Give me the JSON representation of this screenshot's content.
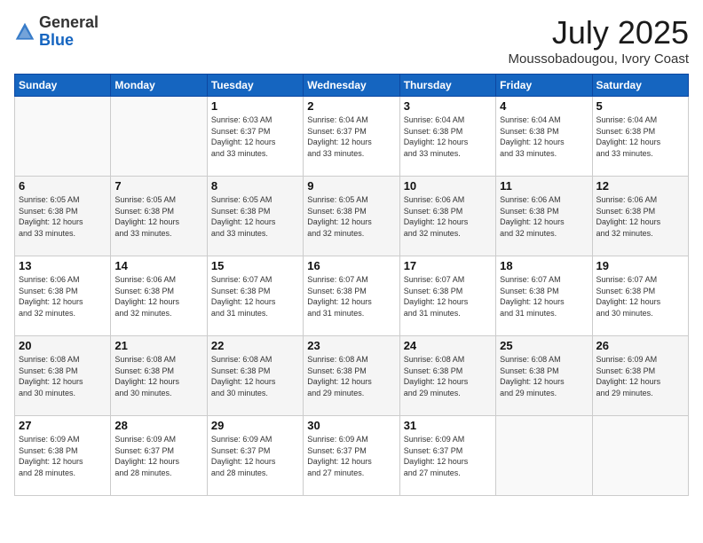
{
  "header": {
    "logo": {
      "general": "General",
      "blue": "Blue"
    },
    "title": "July 2025",
    "location": "Moussobadougou, Ivory Coast"
  },
  "weekdays": [
    "Sunday",
    "Monday",
    "Tuesday",
    "Wednesday",
    "Thursday",
    "Friday",
    "Saturday"
  ],
  "weeks": [
    [
      {
        "day": "",
        "info": ""
      },
      {
        "day": "",
        "info": ""
      },
      {
        "day": "1",
        "info": "Sunrise: 6:03 AM\nSunset: 6:37 PM\nDaylight: 12 hours\nand 33 minutes."
      },
      {
        "day": "2",
        "info": "Sunrise: 6:04 AM\nSunset: 6:37 PM\nDaylight: 12 hours\nand 33 minutes."
      },
      {
        "day": "3",
        "info": "Sunrise: 6:04 AM\nSunset: 6:38 PM\nDaylight: 12 hours\nand 33 minutes."
      },
      {
        "day": "4",
        "info": "Sunrise: 6:04 AM\nSunset: 6:38 PM\nDaylight: 12 hours\nand 33 minutes."
      },
      {
        "day": "5",
        "info": "Sunrise: 6:04 AM\nSunset: 6:38 PM\nDaylight: 12 hours\nand 33 minutes."
      }
    ],
    [
      {
        "day": "6",
        "info": "Sunrise: 6:05 AM\nSunset: 6:38 PM\nDaylight: 12 hours\nand 33 minutes."
      },
      {
        "day": "7",
        "info": "Sunrise: 6:05 AM\nSunset: 6:38 PM\nDaylight: 12 hours\nand 33 minutes."
      },
      {
        "day": "8",
        "info": "Sunrise: 6:05 AM\nSunset: 6:38 PM\nDaylight: 12 hours\nand 33 minutes."
      },
      {
        "day": "9",
        "info": "Sunrise: 6:05 AM\nSunset: 6:38 PM\nDaylight: 12 hours\nand 32 minutes."
      },
      {
        "day": "10",
        "info": "Sunrise: 6:06 AM\nSunset: 6:38 PM\nDaylight: 12 hours\nand 32 minutes."
      },
      {
        "day": "11",
        "info": "Sunrise: 6:06 AM\nSunset: 6:38 PM\nDaylight: 12 hours\nand 32 minutes."
      },
      {
        "day": "12",
        "info": "Sunrise: 6:06 AM\nSunset: 6:38 PM\nDaylight: 12 hours\nand 32 minutes."
      }
    ],
    [
      {
        "day": "13",
        "info": "Sunrise: 6:06 AM\nSunset: 6:38 PM\nDaylight: 12 hours\nand 32 minutes."
      },
      {
        "day": "14",
        "info": "Sunrise: 6:06 AM\nSunset: 6:38 PM\nDaylight: 12 hours\nand 32 minutes."
      },
      {
        "day": "15",
        "info": "Sunrise: 6:07 AM\nSunset: 6:38 PM\nDaylight: 12 hours\nand 31 minutes."
      },
      {
        "day": "16",
        "info": "Sunrise: 6:07 AM\nSunset: 6:38 PM\nDaylight: 12 hours\nand 31 minutes."
      },
      {
        "day": "17",
        "info": "Sunrise: 6:07 AM\nSunset: 6:38 PM\nDaylight: 12 hours\nand 31 minutes."
      },
      {
        "day": "18",
        "info": "Sunrise: 6:07 AM\nSunset: 6:38 PM\nDaylight: 12 hours\nand 31 minutes."
      },
      {
        "day": "19",
        "info": "Sunrise: 6:07 AM\nSunset: 6:38 PM\nDaylight: 12 hours\nand 30 minutes."
      }
    ],
    [
      {
        "day": "20",
        "info": "Sunrise: 6:08 AM\nSunset: 6:38 PM\nDaylight: 12 hours\nand 30 minutes."
      },
      {
        "day": "21",
        "info": "Sunrise: 6:08 AM\nSunset: 6:38 PM\nDaylight: 12 hours\nand 30 minutes."
      },
      {
        "day": "22",
        "info": "Sunrise: 6:08 AM\nSunset: 6:38 PM\nDaylight: 12 hours\nand 30 minutes."
      },
      {
        "day": "23",
        "info": "Sunrise: 6:08 AM\nSunset: 6:38 PM\nDaylight: 12 hours\nand 29 minutes."
      },
      {
        "day": "24",
        "info": "Sunrise: 6:08 AM\nSunset: 6:38 PM\nDaylight: 12 hours\nand 29 minutes."
      },
      {
        "day": "25",
        "info": "Sunrise: 6:08 AM\nSunset: 6:38 PM\nDaylight: 12 hours\nand 29 minutes."
      },
      {
        "day": "26",
        "info": "Sunrise: 6:09 AM\nSunset: 6:38 PM\nDaylight: 12 hours\nand 29 minutes."
      }
    ],
    [
      {
        "day": "27",
        "info": "Sunrise: 6:09 AM\nSunset: 6:38 PM\nDaylight: 12 hours\nand 28 minutes."
      },
      {
        "day": "28",
        "info": "Sunrise: 6:09 AM\nSunset: 6:37 PM\nDaylight: 12 hours\nand 28 minutes."
      },
      {
        "day": "29",
        "info": "Sunrise: 6:09 AM\nSunset: 6:37 PM\nDaylight: 12 hours\nand 28 minutes."
      },
      {
        "day": "30",
        "info": "Sunrise: 6:09 AM\nSunset: 6:37 PM\nDaylight: 12 hours\nand 27 minutes."
      },
      {
        "day": "31",
        "info": "Sunrise: 6:09 AM\nSunset: 6:37 PM\nDaylight: 12 hours\nand 27 minutes."
      },
      {
        "day": "",
        "info": ""
      },
      {
        "day": "",
        "info": ""
      }
    ]
  ]
}
